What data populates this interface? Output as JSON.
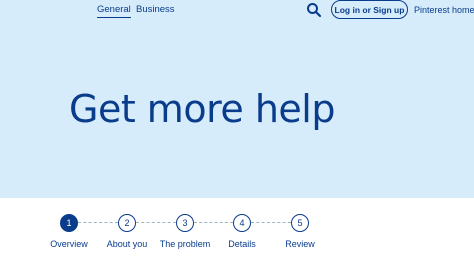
{
  "nav": {
    "tabs": [
      {
        "label": "General",
        "active": true
      },
      {
        "label": "Business",
        "active": false
      }
    ],
    "search_icon": "search-icon",
    "login_label": "Log in or Sign up",
    "home_label": "Pinterest home"
  },
  "hero": {
    "title": "Get more help"
  },
  "stepper": {
    "current_step": 1,
    "steps": [
      {
        "number": "1",
        "label": "Overview"
      },
      {
        "number": "2",
        "label": "About you"
      },
      {
        "number": "3",
        "label": "The problem"
      },
      {
        "number": "4",
        "label": "Details"
      },
      {
        "number": "5",
        "label": "Review"
      }
    ]
  },
  "colors": {
    "hero_background": "#d6ecfb",
    "accent": "#0a3c8c",
    "page_background": "#ffffff"
  }
}
